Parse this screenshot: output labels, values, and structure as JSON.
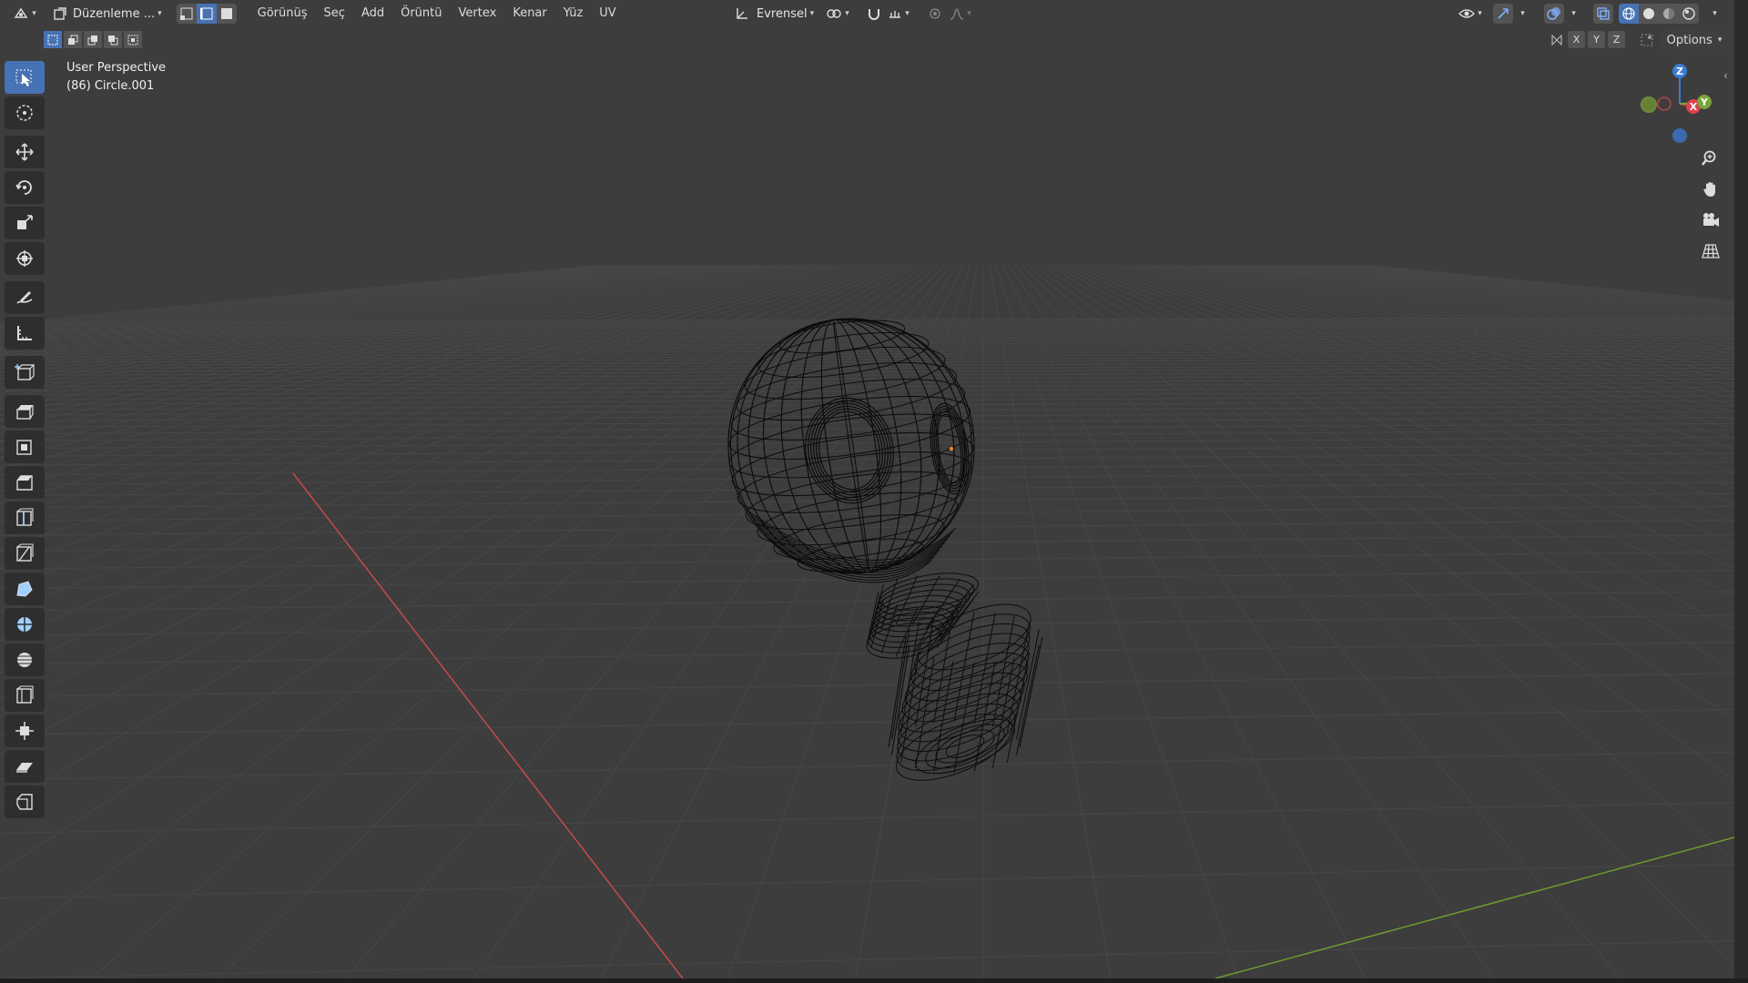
{
  "header": {
    "editor_type_icon": "3d-viewport-icon",
    "mode_label": "Düzenleme ...",
    "menus": [
      "Görünüş",
      "Seç",
      "Add",
      "Örüntü",
      "Vertex",
      "Kenar",
      "Yüz",
      "UV"
    ],
    "transform_orientation": "Evrensel",
    "options_label": "Options",
    "axis_labels": [
      "X",
      "Y",
      "Z"
    ]
  },
  "viewport": {
    "title": "User Perspective",
    "object_info": "(86) Circle.001"
  },
  "gizmo": {
    "z_label": "Z",
    "x_label": "X",
    "y_label": "Y"
  },
  "toolbar": {
    "tools": [
      "select-box-icon",
      "cursor-icon",
      "move-icon",
      "rotate-icon",
      "scale-icon",
      "transform-icon",
      "annotate-icon",
      "measure-icon",
      "add-cube-icon",
      "extrude-icon",
      "inset-icon",
      "bevel-icon",
      "loop-cut-icon",
      "knife-icon",
      "poly-build-icon",
      "spin-icon",
      "smooth-icon",
      "edge-slide-icon",
      "shrink-fatten-icon",
      "shear-icon",
      "rip-icon"
    ]
  },
  "colors": {
    "viewport_bg": "#3d3d3d",
    "active_blue": "#4772b3",
    "x_axis": "#c84a4a",
    "y_axis": "#7aa23a",
    "z_axis": "#3a7bd5",
    "wire": "#0c0c0c"
  }
}
